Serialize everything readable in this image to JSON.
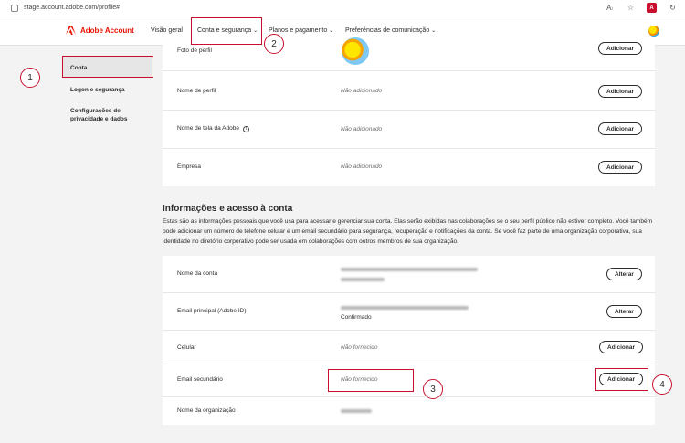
{
  "browser": {
    "url": "stage.account.adobe.com/profile#"
  },
  "header": {
    "brand": "Adobe Account",
    "nav": [
      {
        "label": "Visão geral"
      },
      {
        "label": "Conta e segurança"
      },
      {
        "label": "Planos e pagamento"
      },
      {
        "label": "Preferências de comunicação"
      }
    ]
  },
  "sidebar": {
    "items": [
      {
        "label": "Conta"
      },
      {
        "label": "Logon e segurança"
      },
      {
        "label": "Configurações de privacidade e dados"
      }
    ]
  },
  "profile_card": {
    "rows": [
      {
        "label": "Foto de perfil",
        "button": "Adicionar"
      },
      {
        "label": "Nome de perfil",
        "value": "Não adicionado",
        "button": "Adicionar"
      },
      {
        "label": "Nome de tela da Adobe",
        "value": "Não adicionado",
        "button": "Adicionar"
      },
      {
        "label": "Empresa",
        "value": "Não adicionado",
        "button": "Adicionar"
      }
    ]
  },
  "info_section": {
    "title": "Informações e acesso à conta",
    "description": "Estas são as informações pessoais que você usa para acessar e gerenciar sua conta. Elas serão exibidas nas colaborações se o seu perfil público não estiver completo. Você também pode adicionar um número de telefone celular e um email secundário para segurança, recuperação e notificações da conta. Se você faz parte de uma organização corporativa, sua identidade no diretório corporativo pode ser usada em colaborações com outros membros de sua organização.",
    "rows": [
      {
        "label": "Nome da conta",
        "button": "Alterar"
      },
      {
        "label": "Email principal (Adobe ID)",
        "status": "Confirmado",
        "button": "Alterar"
      },
      {
        "label": "Celular",
        "value": "Não fornecido",
        "button": "Adicionar"
      },
      {
        "label": "Email secundário",
        "value": "Não fornecido",
        "button": "Adicionar"
      },
      {
        "label": "Nome da organização"
      }
    ]
  },
  "annotations": [
    "1",
    "2",
    "3",
    "4"
  ],
  "colors": {
    "accent": "#eb1000",
    "annotation": "#c8102e"
  }
}
